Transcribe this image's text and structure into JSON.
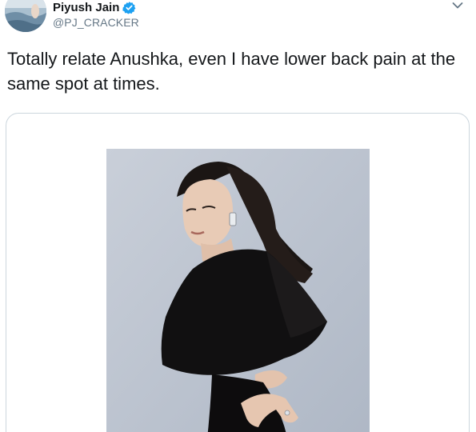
{
  "user": {
    "display_name": "Piyush Jain",
    "handle": "@PJ_CRACKER",
    "verified": true
  },
  "tweet": {
    "text": "Totally relate Anushka, even I have lower back pain at the same spot at times."
  },
  "icons": {
    "verified": "verified-badge-icon",
    "caret": "chevron-down-icon"
  },
  "colors": {
    "name": "#14171a",
    "handle": "#657786",
    "verified": "#1da1f2",
    "card_border": "#ccd6dd",
    "photo_background": "#c0c7d3"
  }
}
